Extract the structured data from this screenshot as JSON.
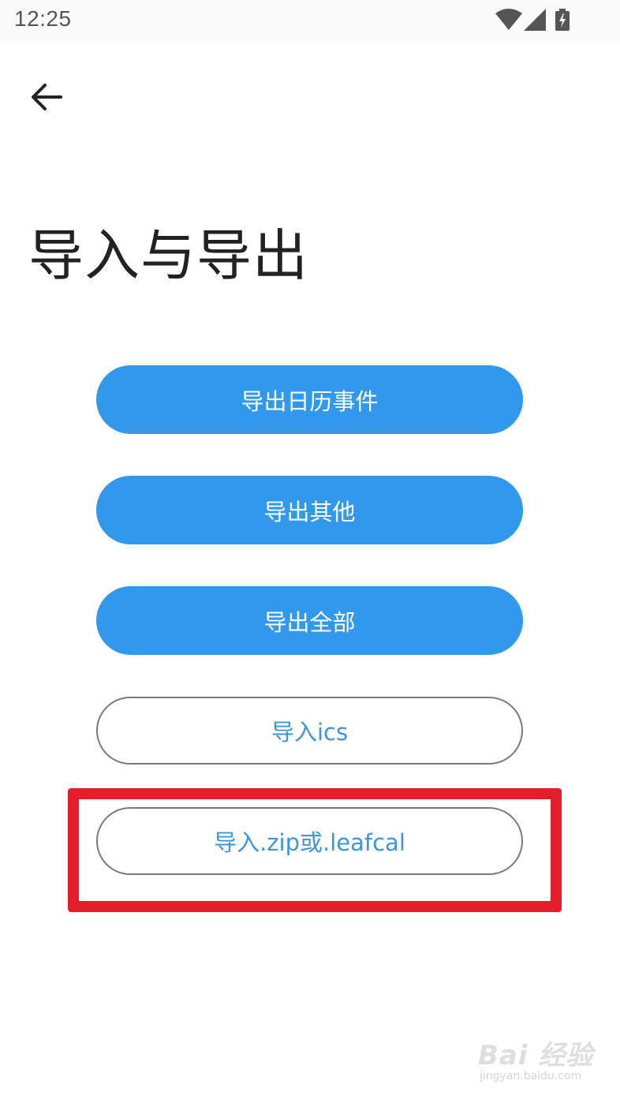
{
  "status_bar": {
    "time": "12:25",
    "icons": [
      "wifi-icon",
      "signal-icon",
      "battery-charging-icon"
    ]
  },
  "header": {
    "back_icon": "arrow-left-icon"
  },
  "page": {
    "title": "导入与导出"
  },
  "buttons": {
    "export_calendar_events": "导出日历事件",
    "export_other": "导出其他",
    "export_all": "导出全部",
    "import_ics": "导入ics",
    "import_zip_leafcal": "导入.zip或.leafcal"
  },
  "annotation": {
    "highlight_color": "#e51d2a"
  },
  "watermark": {
    "logo": "Bai 经验",
    "site": "jingyan.baidu.com"
  },
  "colors": {
    "primary": "#3099ee",
    "outline_text": "#3b95df",
    "outline_border": "#7a7a7a"
  }
}
